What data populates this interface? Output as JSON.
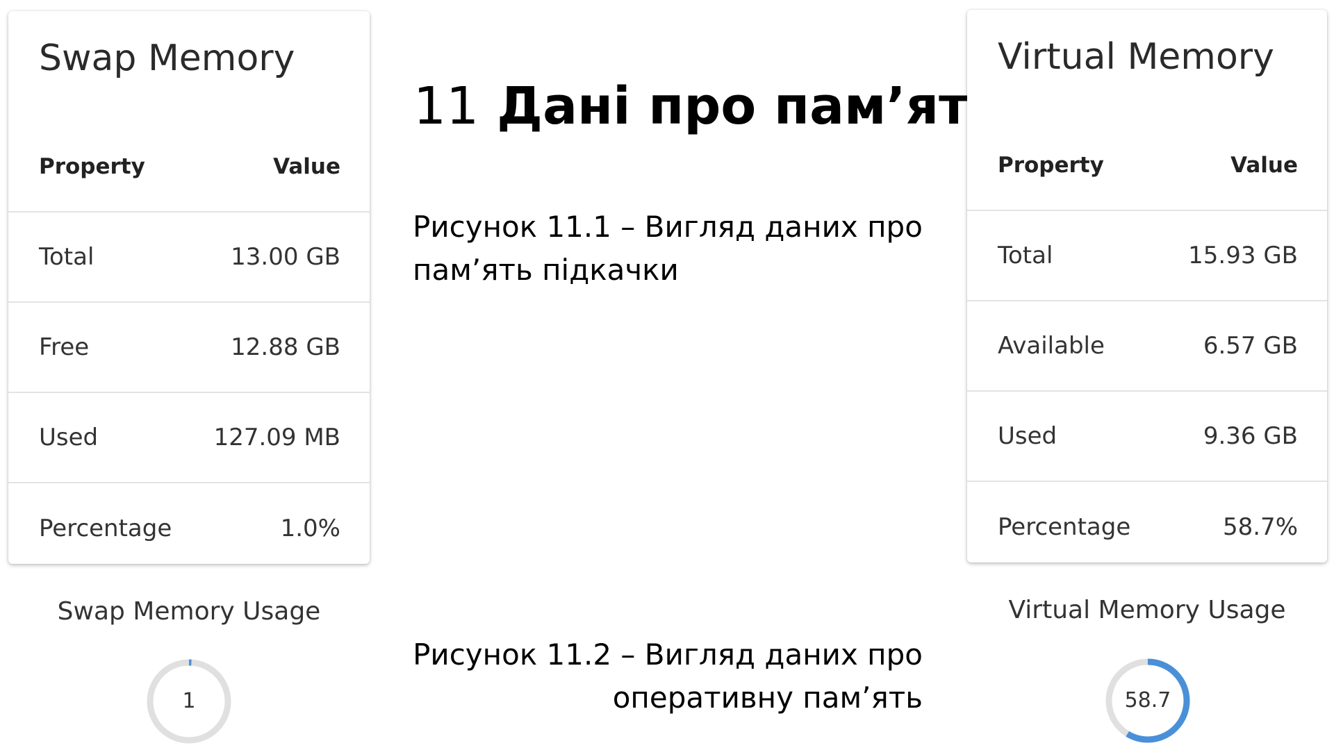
{
  "swap_card": {
    "title": "Swap Memory",
    "header": {
      "property": "Property",
      "value": "Value"
    },
    "rows": [
      {
        "property": "Total",
        "value": "13.00 GB"
      },
      {
        "property": "Free",
        "value": "12.88 GB"
      },
      {
        "property": "Used",
        "value": "127.09 MB"
      },
      {
        "property": "Percentage",
        "value": "1.0%"
      }
    ],
    "usage_label": "Swap Memory Usage",
    "gauge": {
      "value_text": "1",
      "percent": 1.0,
      "color": "#4a90d9",
      "track_color": "#e0e0e0"
    }
  },
  "virtual_card": {
    "title": "Virtual Memory",
    "header": {
      "property": "Property",
      "value": "Value"
    },
    "rows": [
      {
        "property": "Total",
        "value": "15.93 GB"
      },
      {
        "property": "Available",
        "value": "6.57 GB"
      },
      {
        "property": "Used",
        "value": "9.36 GB"
      },
      {
        "property": "Percentage",
        "value": "58.7%"
      }
    ],
    "usage_label": "Virtual Memory Usage",
    "gauge": {
      "value_text": "58.7",
      "percent": 58.7,
      "color": "#4a90d9",
      "track_color": "#e0e0e0"
    }
  },
  "document": {
    "section_number": "11",
    "section_title": "Дані про пам’ять",
    "caption_1": "Рисунок 11.1 – Вигляд даних про пам’ять підкачки",
    "caption_2_line1": "Рисунок 11.2 – Вигляд даних про",
    "caption_2_line2": "оперативну пам’ять"
  }
}
